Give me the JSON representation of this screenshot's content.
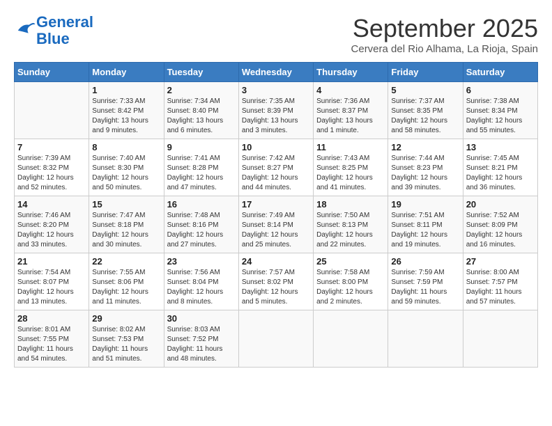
{
  "header": {
    "logo_line1": "General",
    "logo_line2": "Blue",
    "month": "September 2025",
    "location": "Cervera del Rio Alhama, La Rioja, Spain"
  },
  "weekdays": [
    "Sunday",
    "Monday",
    "Tuesday",
    "Wednesday",
    "Thursday",
    "Friday",
    "Saturday"
  ],
  "weeks": [
    [
      {
        "day": "",
        "info": ""
      },
      {
        "day": "1",
        "info": "Sunrise: 7:33 AM\nSunset: 8:42 PM\nDaylight: 13 hours\nand 9 minutes."
      },
      {
        "day": "2",
        "info": "Sunrise: 7:34 AM\nSunset: 8:40 PM\nDaylight: 13 hours\nand 6 minutes."
      },
      {
        "day": "3",
        "info": "Sunrise: 7:35 AM\nSunset: 8:39 PM\nDaylight: 13 hours\nand 3 minutes."
      },
      {
        "day": "4",
        "info": "Sunrise: 7:36 AM\nSunset: 8:37 PM\nDaylight: 13 hours\nand 1 minute."
      },
      {
        "day": "5",
        "info": "Sunrise: 7:37 AM\nSunset: 8:35 PM\nDaylight: 12 hours\nand 58 minutes."
      },
      {
        "day": "6",
        "info": "Sunrise: 7:38 AM\nSunset: 8:34 PM\nDaylight: 12 hours\nand 55 minutes."
      }
    ],
    [
      {
        "day": "7",
        "info": "Sunrise: 7:39 AM\nSunset: 8:32 PM\nDaylight: 12 hours\nand 52 minutes."
      },
      {
        "day": "8",
        "info": "Sunrise: 7:40 AM\nSunset: 8:30 PM\nDaylight: 12 hours\nand 50 minutes."
      },
      {
        "day": "9",
        "info": "Sunrise: 7:41 AM\nSunset: 8:28 PM\nDaylight: 12 hours\nand 47 minutes."
      },
      {
        "day": "10",
        "info": "Sunrise: 7:42 AM\nSunset: 8:27 PM\nDaylight: 12 hours\nand 44 minutes."
      },
      {
        "day": "11",
        "info": "Sunrise: 7:43 AM\nSunset: 8:25 PM\nDaylight: 12 hours\nand 41 minutes."
      },
      {
        "day": "12",
        "info": "Sunrise: 7:44 AM\nSunset: 8:23 PM\nDaylight: 12 hours\nand 39 minutes."
      },
      {
        "day": "13",
        "info": "Sunrise: 7:45 AM\nSunset: 8:21 PM\nDaylight: 12 hours\nand 36 minutes."
      }
    ],
    [
      {
        "day": "14",
        "info": "Sunrise: 7:46 AM\nSunset: 8:20 PM\nDaylight: 12 hours\nand 33 minutes."
      },
      {
        "day": "15",
        "info": "Sunrise: 7:47 AM\nSunset: 8:18 PM\nDaylight: 12 hours\nand 30 minutes."
      },
      {
        "day": "16",
        "info": "Sunrise: 7:48 AM\nSunset: 8:16 PM\nDaylight: 12 hours\nand 27 minutes."
      },
      {
        "day": "17",
        "info": "Sunrise: 7:49 AM\nSunset: 8:14 PM\nDaylight: 12 hours\nand 25 minutes."
      },
      {
        "day": "18",
        "info": "Sunrise: 7:50 AM\nSunset: 8:13 PM\nDaylight: 12 hours\nand 22 minutes."
      },
      {
        "day": "19",
        "info": "Sunrise: 7:51 AM\nSunset: 8:11 PM\nDaylight: 12 hours\nand 19 minutes."
      },
      {
        "day": "20",
        "info": "Sunrise: 7:52 AM\nSunset: 8:09 PM\nDaylight: 12 hours\nand 16 minutes."
      }
    ],
    [
      {
        "day": "21",
        "info": "Sunrise: 7:54 AM\nSunset: 8:07 PM\nDaylight: 12 hours\nand 13 minutes."
      },
      {
        "day": "22",
        "info": "Sunrise: 7:55 AM\nSunset: 8:06 PM\nDaylight: 12 hours\nand 11 minutes."
      },
      {
        "day": "23",
        "info": "Sunrise: 7:56 AM\nSunset: 8:04 PM\nDaylight: 12 hours\nand 8 minutes."
      },
      {
        "day": "24",
        "info": "Sunrise: 7:57 AM\nSunset: 8:02 PM\nDaylight: 12 hours\nand 5 minutes."
      },
      {
        "day": "25",
        "info": "Sunrise: 7:58 AM\nSunset: 8:00 PM\nDaylight: 12 hours\nand 2 minutes."
      },
      {
        "day": "26",
        "info": "Sunrise: 7:59 AM\nSunset: 7:59 PM\nDaylight: 11 hours\nand 59 minutes."
      },
      {
        "day": "27",
        "info": "Sunrise: 8:00 AM\nSunset: 7:57 PM\nDaylight: 11 hours\nand 57 minutes."
      }
    ],
    [
      {
        "day": "28",
        "info": "Sunrise: 8:01 AM\nSunset: 7:55 PM\nDaylight: 11 hours\nand 54 minutes."
      },
      {
        "day": "29",
        "info": "Sunrise: 8:02 AM\nSunset: 7:53 PM\nDaylight: 11 hours\nand 51 minutes."
      },
      {
        "day": "30",
        "info": "Sunrise: 8:03 AM\nSunset: 7:52 PM\nDaylight: 11 hours\nand 48 minutes."
      },
      {
        "day": "",
        "info": ""
      },
      {
        "day": "",
        "info": ""
      },
      {
        "day": "",
        "info": ""
      },
      {
        "day": "",
        "info": ""
      }
    ]
  ]
}
